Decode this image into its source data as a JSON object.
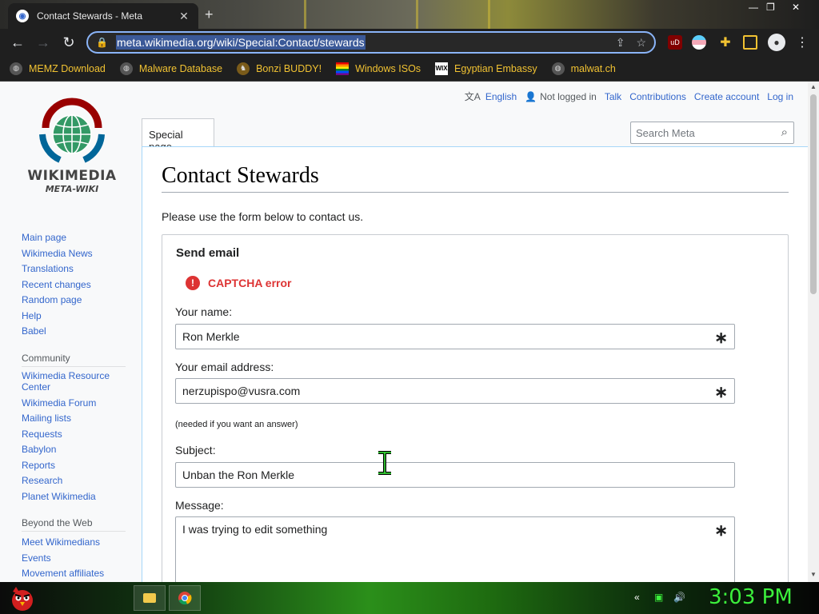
{
  "browser": {
    "tab_title": "Contact Stewards - Meta",
    "tab_close": "✕",
    "new_tab": "+",
    "url": "meta.wikimedia.org/wiki/Special:Contact/stewards",
    "bookmarks": [
      {
        "label": "MEMZ Download",
        "icon": "globe-icon"
      },
      {
        "label": "Malware Database",
        "icon": "globe-icon"
      },
      {
        "label": "Bonzi BUDDY!",
        "icon": "bonzi-icon"
      },
      {
        "label": "Windows ISOs",
        "icon": "windows-icon"
      },
      {
        "label": "Egyptian Embassy",
        "icon": "wix-icon"
      },
      {
        "label": "malwat.ch",
        "icon": "globe-icon"
      }
    ],
    "accent": "#8ab4f8"
  },
  "wiki": {
    "logo_text": "WIKIMEDIA",
    "logo_sub": "META-WIKI",
    "top_links": {
      "language": "English",
      "not_logged_in": "Not logged in",
      "talk": "Talk",
      "contributions": "Contributions",
      "create_account": "Create account",
      "login": "Log in"
    },
    "special_tab": "Special page",
    "search_placeholder": "Search Meta",
    "nav": {
      "main": [
        "Main page",
        "Wikimedia News",
        "Translations",
        "Recent changes",
        "Random page",
        "Help",
        "Babel"
      ],
      "community_heading": "Community",
      "community": [
        "Wikimedia Resource Center",
        "Wikimedia Forum",
        "Mailing lists",
        "Requests",
        "Babylon",
        "Reports",
        "Research",
        "Planet Wikimedia"
      ],
      "beyond_heading": "Beyond the Web",
      "beyond": [
        "Meet Wikimedians",
        "Events",
        "Movement affiliates"
      ]
    },
    "title": "Contact Stewards",
    "intro": "Please use the form below to contact us.",
    "form": {
      "legend": "Send email",
      "error": "CAPTCHA error",
      "name_label": "Your name:",
      "name_value": "Ron Merkle",
      "email_label": "Your email address:",
      "email_value": "nerzupispo@vusra.com",
      "email_hint": "(needed if you want an answer)",
      "subject_label": "Subject:",
      "subject_value": "Unban the Ron Merkle",
      "message_label": "Message:",
      "message_value": "I was trying to edit something",
      "required_mark": "∗"
    }
  },
  "taskbar": {
    "clock": "3:03 PM"
  }
}
